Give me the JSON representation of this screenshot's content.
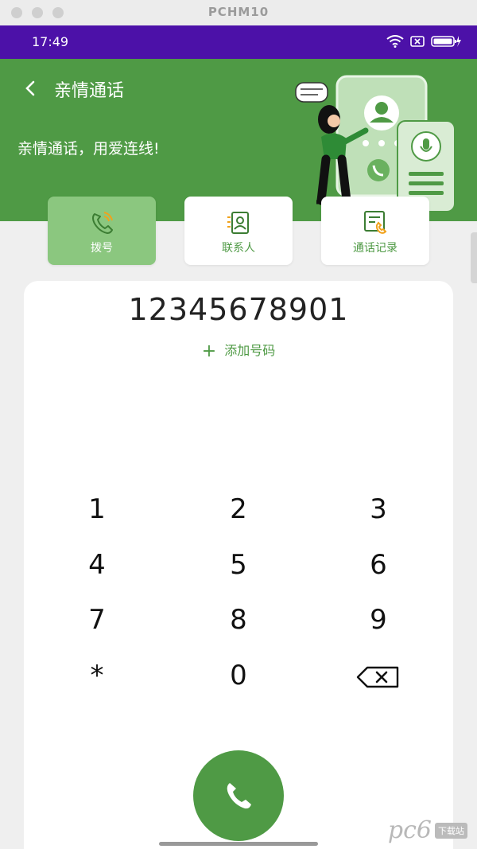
{
  "window": {
    "title": "PCHM10"
  },
  "status": {
    "time": "17:49"
  },
  "header": {
    "title": "亲情通话",
    "slogan": "亲情通话，用爱连线!"
  },
  "tabs": [
    {
      "label": "拨号",
      "icon": "phone-ring-icon",
      "active": true
    },
    {
      "label": "联系人",
      "icon": "contacts-icon",
      "active": false
    },
    {
      "label": "通话记录",
      "icon": "call-log-icon",
      "active": false
    }
  ],
  "dialer": {
    "number": "12345678901",
    "add_label": "添加号码",
    "add_icon": "+",
    "keys": [
      "1",
      "2",
      "3",
      "4",
      "5",
      "6",
      "7",
      "8",
      "9",
      "*",
      "0"
    ],
    "backspace_icon": "backspace-icon",
    "call_icon": "phone-icon"
  },
  "watermark": {
    "logo": "pc6",
    "text": "下载站"
  },
  "colors": {
    "primary": "#4f9a45",
    "status_bar": "#4c11a8",
    "active_tab": "#8bc77f"
  }
}
